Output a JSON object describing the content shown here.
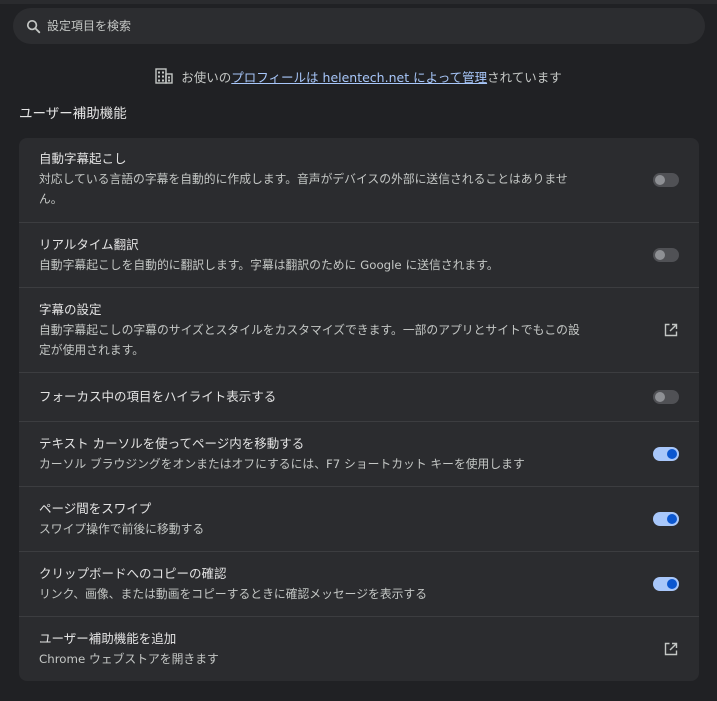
{
  "search": {
    "placeholder": "設定項目を検索"
  },
  "managed": {
    "prefix": "お使いの",
    "link": "プロフィールは helentech.net によって管理",
    "suffix": "されています"
  },
  "section": {
    "title": "ユーザー補助機能"
  },
  "rows": [
    {
      "title": "自動字幕起こし",
      "desc_line1": "対応している言語の字幕を自動的に作成します。音声がデバイスの外部に送信されることはありませ",
      "desc_line2": "ん。",
      "control": "toggle",
      "state": "off"
    },
    {
      "title": "リアルタイム翻訳",
      "desc_line1": "自動字幕起こしを自動的に翻訳します。字幕は翻訳のために Google に送信されます。",
      "control": "toggle",
      "state": "off"
    },
    {
      "title": "字幕の設定",
      "desc_line1": "自動字幕起こしの字幕のサイズとスタイルをカスタマイズできます。一部のアプリとサイトでもこの設",
      "desc_line2": "定が使用されます。",
      "control": "external-link-icon"
    },
    {
      "title": "フォーカス中の項目をハイライト表示する",
      "control": "toggle",
      "state": "off"
    },
    {
      "title": "テキスト カーソルを使ってページ内を移動する",
      "desc_line1": "カーソル ブラウジングをオンまたはオフにするには、F7 ショートカット キーを使用します",
      "control": "toggle",
      "state": "on"
    },
    {
      "title": "ページ間をスワイプ",
      "desc_line1": "スワイプ操作で前後に移動する",
      "control": "toggle",
      "state": "on"
    },
    {
      "title": "クリップボードへのコピーの確認",
      "desc_line1": "リンク、画像、または動画をコピーするときに確認メッセージを表示する",
      "control": "toggle",
      "state": "on"
    },
    {
      "title": "ユーザー補助機能を追加",
      "desc_line1": "Chrome ウェブストアを開きます",
      "control": "external-link-icon"
    }
  ],
  "colors": {
    "background": "#202124",
    "card": "#2b2c2f",
    "accent": "#a8c7fa",
    "toggle_on_knob": "#0b57d0"
  }
}
